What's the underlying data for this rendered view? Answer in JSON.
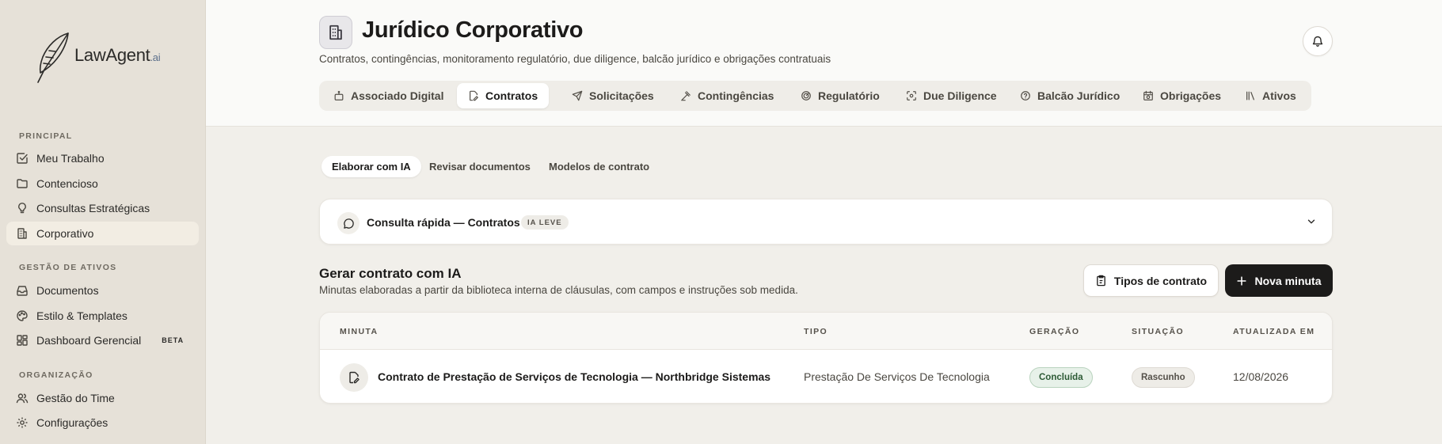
{
  "brand": {
    "name": "LawAgent",
    "suffix": ".ai"
  },
  "sidebar": {
    "sections": [
      {
        "label": "PRINCIPAL"
      },
      {
        "label": "GESTÃO DE ATIVOS"
      },
      {
        "label": "ORGANIZAÇÃO"
      }
    ],
    "items": [
      {
        "label": "Meu Trabalho",
        "icon": "check-square-icon"
      },
      {
        "label": "Contencioso",
        "icon": "folder-icon"
      },
      {
        "label": "Consultas Estratégicas",
        "icon": "lightbulb-icon"
      },
      {
        "label": "Corporativo",
        "icon": "building-icon",
        "active": true
      },
      {
        "label": "Documentos",
        "icon": "inbox-icon"
      },
      {
        "label": "Estilo & Templates",
        "icon": "palette-icon"
      },
      {
        "label": "Dashboard Gerencial",
        "icon": "dashboard-icon",
        "badge": "BETA"
      },
      {
        "label": "Gestão do Time",
        "icon": "users-icon"
      },
      {
        "label": "Configurações",
        "icon": "gear-icon"
      }
    ]
  },
  "header": {
    "title": "Jurídico Corporativo",
    "subtitle": "Contratos, contingências, monitoramento regulatório, due diligence, balcão jurídico e obrigações contratuais",
    "tabs": [
      {
        "label": "Associado Digital",
        "icon": "robot-icon"
      },
      {
        "label": "Contratos",
        "icon": "file-pen-icon",
        "active": true
      },
      {
        "label": "Solicitações",
        "icon": "send-icon"
      },
      {
        "label": "Contingências",
        "icon": "gavel-icon"
      },
      {
        "label": "Regulatório",
        "icon": "radar-icon"
      },
      {
        "label": "Due Diligence",
        "icon": "scan-icon"
      },
      {
        "label": "Balcão Jurídico",
        "icon": "help-circle-icon"
      },
      {
        "label": "Obrigações",
        "icon": "calendar-clock-icon"
      },
      {
        "label": "Ativos",
        "icon": "library-icon"
      }
    ]
  },
  "subtabs": [
    {
      "label": "Elaborar com IA",
      "active": true
    },
    {
      "label": "Revisar documentos"
    },
    {
      "label": "Modelos de contrato"
    }
  ],
  "quick": {
    "title": "Consulta rápida — Contratos",
    "badge": "IA LEVE"
  },
  "section": {
    "title": "Gerar contrato com IA",
    "subtitle": "Minutas elaboradas a partir da biblioteca interna de cláusulas, com campos e instruções sob medida.",
    "types_button": "Tipos de contrato",
    "new_button": "Nova minuta"
  },
  "table": {
    "columns": [
      "MINUTA",
      "TIPO",
      "GERAÇÃO",
      "SITUAÇÃO",
      "ATUALIZADA EM"
    ],
    "rows": [
      {
        "name": "Contrato de Prestação de Serviços de Tecnologia — Northbridge Sistemas",
        "type": "Prestação De Serviços De Tecnologia",
        "generation": "Concluída",
        "status": "Rascunho",
        "updated": "12/08/2026"
      }
    ]
  },
  "colors": {
    "primary": "#1c1b1a",
    "sidebar_bg": "#e6e1d8",
    "page_bg": "#f1efea",
    "success": "#2c5a35"
  }
}
